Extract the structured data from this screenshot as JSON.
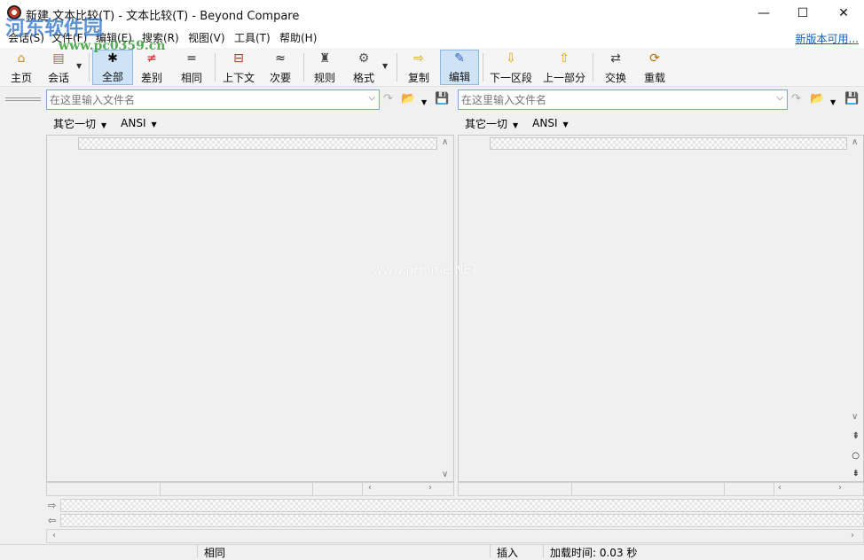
{
  "window": {
    "title": "新建 文本比较(T) - 文本比较(T) - Beyond Compare",
    "minimize": "—",
    "maximize": "☐",
    "close": "✕"
  },
  "menu": {
    "items": [
      "会话(S)",
      "文件(F)",
      "编辑(E)",
      "搜索(R)",
      "视图(V)",
      "工具(T)",
      "帮助(H)"
    ],
    "new_version": "新版本可用..."
  },
  "toolbar": {
    "buttons": [
      {
        "label": "主页",
        "icon": "home-icon",
        "glyph": "⌂"
      },
      {
        "label": "会话",
        "icon": "briefcase-icon",
        "glyph": "▤"
      },
      {
        "label": "全部",
        "icon": "asterisk-icon",
        "glyph": "✱"
      },
      {
        "label": "差别",
        "icon": "not-equal-icon",
        "glyph": "≠"
      },
      {
        "label": "相同",
        "icon": "equal-icon",
        "glyph": "="
      },
      {
        "label": "上下文",
        "icon": "context-icon",
        "glyph": "⊟"
      },
      {
        "label": "次要",
        "icon": "approx-icon",
        "glyph": "≈"
      },
      {
        "label": "规则",
        "icon": "referee-icon",
        "glyph": "♜"
      },
      {
        "label": "格式",
        "icon": "format-gear-icon",
        "glyph": "⚙"
      },
      {
        "label": "复制",
        "icon": "copy-arrow-icon",
        "glyph": "⇨"
      },
      {
        "label": "编辑",
        "icon": "edit-pencil-icon",
        "glyph": "✎"
      },
      {
        "label": "下一区段",
        "icon": "next-section-icon",
        "glyph": "⇩"
      },
      {
        "label": "上一部分",
        "icon": "prev-section-icon",
        "glyph": "⇧"
      },
      {
        "label": "交换",
        "icon": "swap-icon",
        "glyph": "⇄"
      },
      {
        "label": "重载",
        "icon": "reload-icon",
        "glyph": "⟳"
      }
    ],
    "active": "编辑",
    "active_view": "全部"
  },
  "left": {
    "placeholder": "在这里输入文件名",
    "encoding_menu": "其它一切",
    "encoding": "ANSI"
  },
  "right": {
    "placeholder": "在这里输入文件名",
    "encoding_menu": "其它一切",
    "encoding": "ANSI"
  },
  "statusbar": {
    "state": "相同",
    "mode": "插入",
    "load_time": "加载时间: 0.03 秒"
  },
  "watermarks": {
    "logo": "河东软件园",
    "url": "www.pc0359.cn",
    "center": "www.pHome.NET"
  },
  "colors": {
    "accent": "#1a5fb4",
    "active_button_bg": "#cfe3f6"
  }
}
